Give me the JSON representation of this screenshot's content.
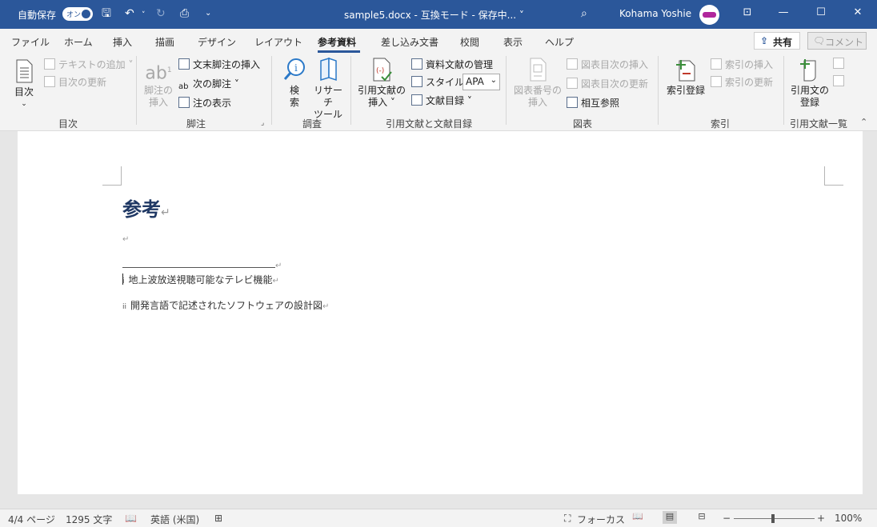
{
  "titlebar": {
    "autosave_label": "自動保存",
    "autosave_state": "オン",
    "doc_title": "sample5.docx  -  互換モード - 保存中...  ˅",
    "user_name": "Kohama Yoshie"
  },
  "menu": {
    "tabs": [
      "ファイル",
      "ホーム",
      "挿入",
      "描画",
      "デザイン",
      "レイアウト",
      "参考資料",
      "差し込み文書",
      "校閲",
      "表示",
      "ヘルプ"
    ],
    "active_tab": "参考資料",
    "share_label": "共有",
    "comment_label": "コメント"
  },
  "ribbon": {
    "toc": {
      "toc_button": "目次",
      "add_text": "テキストの追加 ˅",
      "update_toc": "目次の更新",
      "group": "目次"
    },
    "footnotes": {
      "insert_footnote_1": "脚注の",
      "insert_footnote_2": "挿入",
      "insert_endnote": "文末脚注の挿入",
      "next_footnote": "次の脚注  ˅",
      "show_notes": "注の表示",
      "group": "脚注"
    },
    "research": {
      "search_1": "検",
      "search_2": "索",
      "researcher_1": "リサーチ",
      "researcher_2": "ツール",
      "group": "調査"
    },
    "citations": {
      "insert_citation_1": "引用文献の",
      "insert_citation_2": "挿入 ˅",
      "manage_sources": "資料文献の管理",
      "style_label": "スタイル:",
      "style_value": "APA",
      "bibliography": "文献目録 ˅",
      "group": "引用文献と文献目録"
    },
    "captions": {
      "insert_caption_1": "図表番号の",
      "insert_caption_2": "挿入",
      "insert_table_of_figures": "図表目次の挿入",
      "update_table": "図表目次の更新",
      "cross_reference": "相互参照",
      "group": "図表"
    },
    "index": {
      "mark_entry": "索引登録",
      "insert_index": "索引の挿入",
      "update_index": "索引の更新",
      "group": "索引"
    },
    "authorities": {
      "mark_citation_1": "引用文の",
      "mark_citation_2": "登録",
      "group": "引用文献一覧"
    }
  },
  "document": {
    "heading": "参考",
    "paragraph_mark": "↵",
    "footnotes": [
      {
        "ref": "i",
        "text": "地上波放送視聴可能なテレビ機能"
      },
      {
        "ref": "ii",
        "text": "開発言語で記述されたソフトウェアの設計図"
      }
    ]
  },
  "statusbar": {
    "page": "4/4 ページ",
    "words": "1295 文字",
    "language": "英語 (米国)",
    "focus": "フォーカス",
    "zoom_level": "100%",
    "zoom_minus": "−",
    "zoom_plus": "+"
  },
  "colors": {
    "titlebar": "#2b579a",
    "heading": "#1f3864",
    "accent": "#2b579a"
  }
}
